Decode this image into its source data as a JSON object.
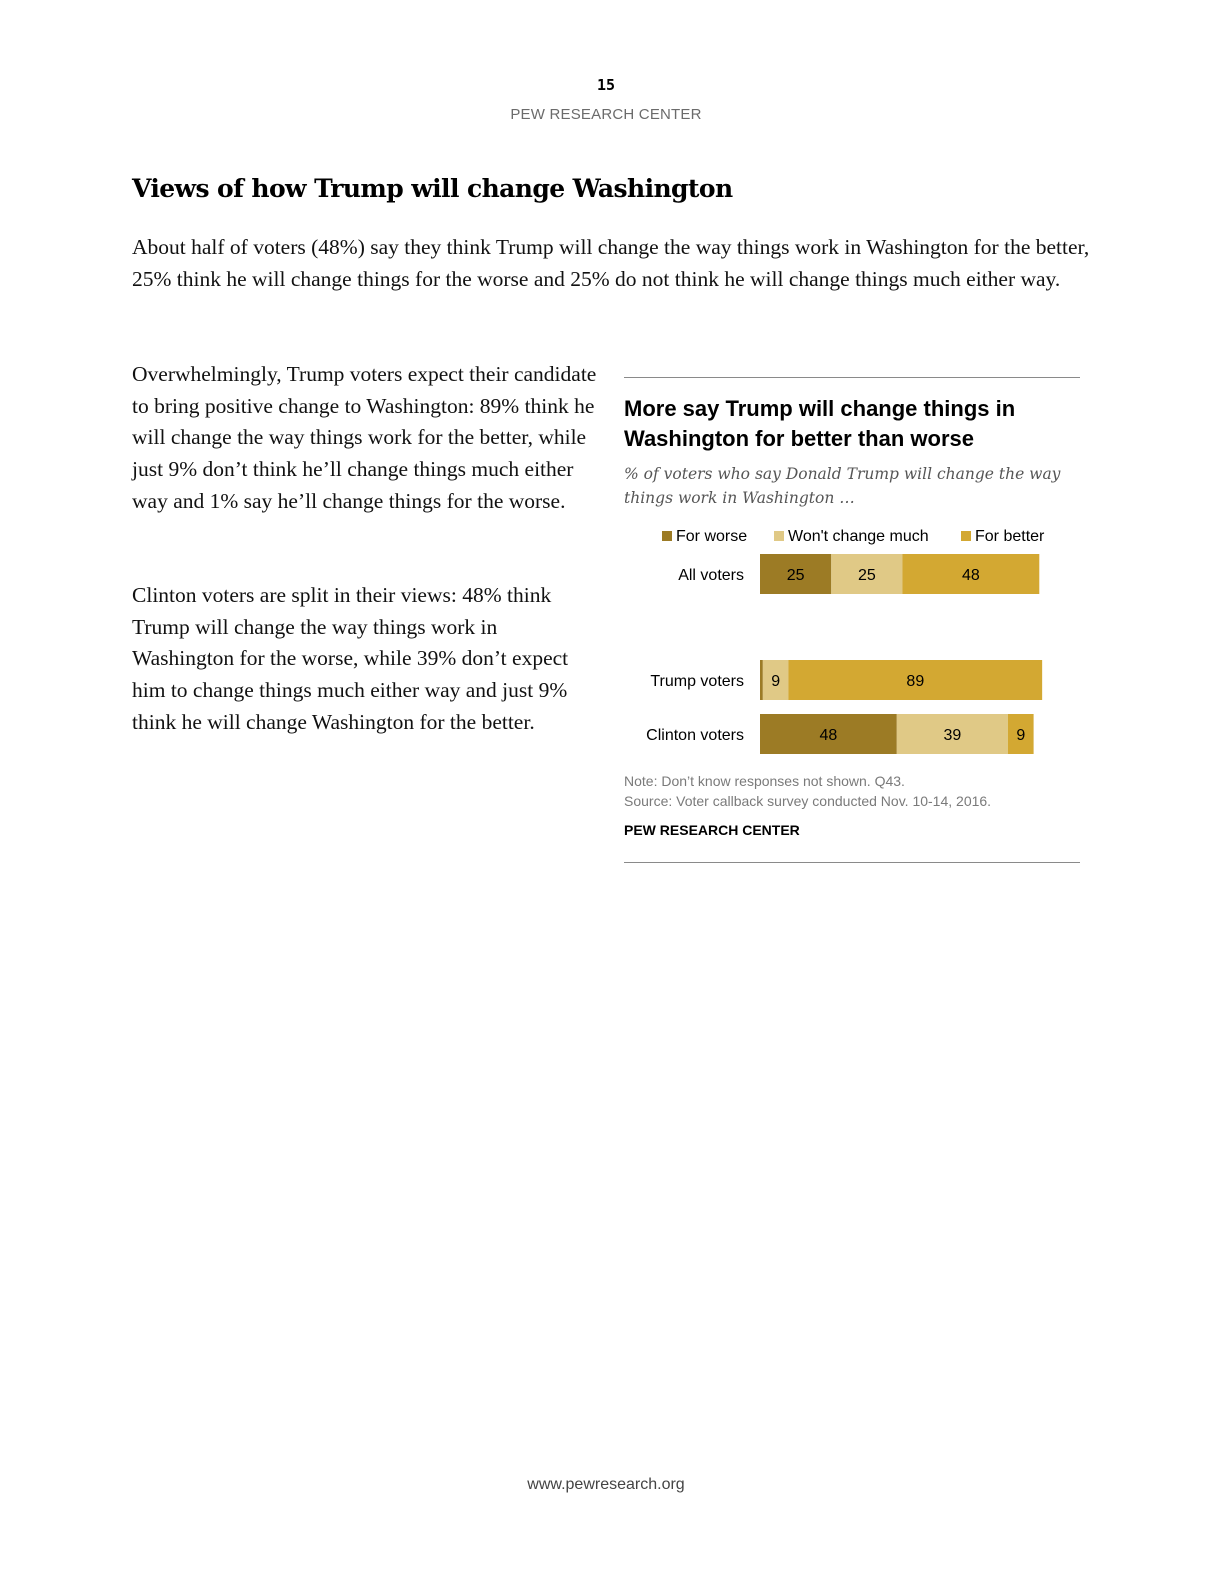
{
  "header": {
    "page_number": "15",
    "org": "PEW RESEARCH CENTER"
  },
  "section_title": "Views of how Trump will change Washington",
  "paragraphs": {
    "intro": "About half of voters (48%) say they think Trump will change the way things work in Washington for the better, 25% think he will change things for the worse and 25% do not think he will change things much either way.",
    "trump_voters": "Overwhelmingly, Trump voters expect their candidate to bring positive change to Washington: 89% think he will change the way things work for the better, while just 9% don’t think he’ll change things much either way and 1% say he’ll change things for the worse.",
    "clinton_voters": "Clinton voters are split in their views: 48% think Trump will change the way things work in Washington for the worse, while 39% don’t expect him to change things much either way and just 9% think he will change Washington for the better."
  },
  "chart": {
    "title": "More say Trump will change things in Washington for better than worse",
    "subtitle": "% of voters who say Donald Trump will change the way things work in Washington …",
    "note": "Note: Don’t know responses not shown. Q43.",
    "source": "Source: Voter callback survey conducted Nov. 10-14, 2016.",
    "credit": "PEW RESEARCH CENTER"
  },
  "chart_data": {
    "type": "bar",
    "orientation": "horizontal",
    "stacked": true,
    "categories": [
      "All voters",
      "Trump voters",
      "Clinton voters"
    ],
    "series": [
      {
        "name": "For worse",
        "color": "#9c7b25",
        "values": [
          25,
          1,
          48
        ],
        "labels": [
          "25",
          "",
          "48"
        ]
      },
      {
        "name": "Won't change much",
        "color": "#e0c986",
        "values": [
          25,
          9,
          39
        ],
        "labels": [
          "25",
          "9",
          "39"
        ]
      },
      {
        "name": "For better",
        "color": "#d3a832",
        "values": [
          48,
          89,
          9
        ],
        "labels": [
          "48",
          "89",
          "9"
        ]
      }
    ],
    "xlim": [
      0,
      100
    ],
    "legend": "top",
    "grid": false
  },
  "footer": {
    "url": "www.pewresearch.org"
  }
}
